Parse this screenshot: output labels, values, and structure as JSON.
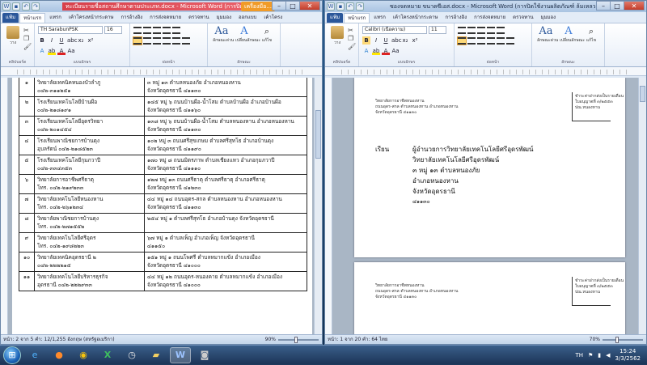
{
  "left_window": {
    "title": "ทะเบียนรายชื่อสถานศึกษาตามประเภท.docx - Microsoft Word (การปิดใช้งาน...",
    "context_tab": "เครื่องมือ...",
    "tabs": [
      "แฟ้ม",
      "หน้าแรก",
      "แทรก",
      "เค้าโครงหน้ากระดาษ",
      "การอ้างอิง",
      "การส่งจดหมาย",
      "ตรวจทาน",
      "มุมมอง",
      "ออกแบบ",
      "เค้าโครง"
    ],
    "font_name": "TH SarabunPSK",
    "font_size": "16",
    "rows": [
      {
        "no": "๑",
        "name_1": "วิทยาลัยเทคนิคหนองบัวลำภู",
        "name_2": "๐๔๒-๓๑๑๒๕๑",
        "addr_1": "๓ หมู่ ๑๓ ตำบลหนองภัย อำเภอหนองหาน",
        "addr_2": "จังหวัดอุดรธานี ๔๑๑๓๐"
      },
      {
        "no": "๒",
        "name_1": "โรงเรียนเทคโนโลยีบ้านผือ",
        "name_2": "๐๔๒-๒๑๘๑๙๑",
        "addr_1": "๑๔๕ หมู่ ๖ ถนนบ้านผือ-น้ำโสม ตำบลบ้านผือ อำเภอบ้านผือ",
        "addr_2": "จังหวัดอุดรธานี ๔๑๑๖๐"
      },
      {
        "no": "๓",
        "name_1": "โรงเรียนเทคโนโลยีอุดรวิทยา",
        "name_2": "๐๔๒-๒๐๑๔๕๔",
        "addr_1": "๑๓๘ หมู่ ๖ ถนนบ้านผือ-น้ำโสม ตำบลหนองหาน อำเภอหนองหาน",
        "addr_2": "จังหวัดอุดรธานี ๔๑๑๓๐"
      },
      {
        "no": "๔",
        "name_1": "โรงเรียนพาณิชยการบ้านดุง",
        "name_2": "อุบลรัตน์ ๐๔๒-๒๑๘๕๒๓",
        "addr_1": "๑๐๒ หมู่ ๓ ถนนศรีสุขเกษม ตำบลศรีสุทโธ อำเภอบ้านดุง",
        "addr_2": "จังหวัดอุดรธานี ๔๑๑๙๐"
      },
      {
        "no": "๕",
        "name_1": "โรงเรียนเทคโนโลยีกุมภวาปี",
        "name_2": "๐๔๒-๓๓๔๓๕๓",
        "addr_1": "๑๗๐ หมู่ ๘ ถนนมิตรภาพ ตำบลเชียงแหว อำเภอกุมภวาปี",
        "addr_2": "จังหวัดอุดรธานี ๔๑๑๑๐"
      },
      {
        "no": "๖",
        "name_1": "วิทยาลัยการอาชีพศรีธาตุ",
        "name_2": "โทร. ๐๔๒-๒๑๙๒๓๓",
        "addr_1": "๑๒๗ หมู่ ๑๓ ถนนศรีธาตุ ตำบลศรีธาตุ อำเภอศรีธาตุ",
        "addr_2": "จังหวัดอุดรธานี ๔๑๒๓๐"
      },
      {
        "no": "๗",
        "name_1": "วิทยาลัยเทคโนโลยีหนองหาน",
        "name_2": "โทร. ๐๔๒-๒๖๑๒๓๔",
        "addr_1": "๔๔ หมู่ ๑๔ ถนนอุดร-สกล ตำบลหนองหาน อำเภอหนองหาน",
        "addr_2": "จังหวัดอุดรธานี ๔๑๑๓๐"
      },
      {
        "no": "๘",
        "name_1": "วิทยาลัยพาณิชยการบ้านดุง",
        "name_2": "โทร. ๐๔๒-๒๗๑๕๕๒",
        "addr_1": "๒๕๔ หมู่ ๑ ตำบลศรีสุทโธ อำเภอบ้านดุง จังหวัดอุดรธานี",
        "addr_2": ""
      },
      {
        "no": "๙",
        "name_1": "วิทยาลัยเทคโนโลยีศรีอุดร",
        "name_2": "โทร. ๐๔๒-๑๙๘๒๒๓",
        "addr_1": "๖๗ หมู่ ๑ ตำบลเพ็ญ อำเภอเพ็ญ จังหวัดอุดรธานี",
        "addr_2": "๔๑๑๕๐"
      },
      {
        "no": "๑๐",
        "name_1": "วิทยาลัยเทคนิคอุดรธานี ๒",
        "name_2": "๐๔๒-๒๒๒๒๑๕",
        "addr_1": "๑๕๑ หมู่ ๑ ถนนโพศรี ตำบลหมากแข้ง อำเภอเมือง",
        "addr_2": "จังหวัดอุดรธานี ๔๑๐๐๐"
      },
      {
        "no": "๑๑",
        "name_1": "วิทยาลัยเทคโนโลยีบริหารธุรกิจ",
        "name_2": "อุดรธานี ๐๔๒-๒๒๒๙๓๓",
        "addr_1": "๔๔ หมู่ ๑๒ ถนนอุดร-หนองคาย ตำบลหมากแข้ง อำเภอเมือง",
        "addr_2": "จังหวัดอุดรธานี ๔๑๐๐๐"
      }
    ],
    "status": "หน้า: 2 จาก 5   คำ: 12/1,255   อังกฤษ (สหรัฐอเมริกา)",
    "zoom": "90%"
  },
  "right_window": {
    "title": "ซองจดหมาย ขนาดซีเอส.docx - Microsoft Word (การปิดใช้งานผลิตภัณฑ์ ล้มเหลว)",
    "tabs": [
      "แฟ้ม",
      "หน้าแรก",
      "แทรก",
      "เค้าโครงหน้ากระดาษ",
      "การอ้างอิง",
      "การส่งจดหมาย",
      "ตรวจทาน",
      "มุมมอง"
    ],
    "font_name": "Calibri (เนื้อความ)",
    "font_size": "11",
    "sender_lines": [
      "วิทยาลัยการอาชีพหนองหาน",
      "ถนนอุดร-สกล ตำบลหนองหาน อำเภอหนองหาน",
      "จังหวัดอุดรธานี ๔๑๑๓๐"
    ],
    "stamp_lines": [
      "ชำระค่าฝากส่งเป็นรายเดือน",
      "ใบอนุญาตที่ ๓/๒๕๕๓",
      "ปณ.หนองหาน"
    ],
    "recipient_label": "เรียน",
    "recipient_lines": [
      "ผู้อำนวยการวิทยาลัยเทคโนโลยีศรีอุดรพัฒน์",
      "วิทยาลัยเทคโนโลยีศรีอุดรพัฒน์",
      "๓ หมู่ ๑๓ ตำบลหนองภัย",
      "อำเภอหนองหาน",
      "จังหวัดอุดรธานี"
    ],
    "postcode": "๔๑๑๓๐",
    "page2_sender": [
      "วิทยาลัยการอาชีพหนองหาน",
      "ถนนอุดร-สกล ตำบลหนองหาน อำเภอหนองหาน",
      "จังหวัดอุดรธานี ๔๑๑๓๐"
    ],
    "page2_stamp": [
      "ชำระค่าฝากส่งเป็นรายเดือน",
      "ใบอนุญาตที่ ๓/๒๕๕๓",
      "ปณ.หนองหาน"
    ],
    "status": "หน้า: 1 จาก 20   คำ: 64   ไทย",
    "zoom": "70%"
  },
  "ribbon_labels": {
    "paste": "วาง",
    "clipboard": "คลิปบอร์ด",
    "font_group": "แบบอักษร",
    "para_group": "ย่อหน้า",
    "styles_group": "ลักษณะ",
    "quick_styles": "ลักษณะด่วน",
    "change_styles": "เปลี่ยนลักษณะ",
    "edit": "แก้ไข"
  },
  "taskbar": {
    "language": "TH",
    "time": "15:24",
    "date": "3/3/2562"
  }
}
